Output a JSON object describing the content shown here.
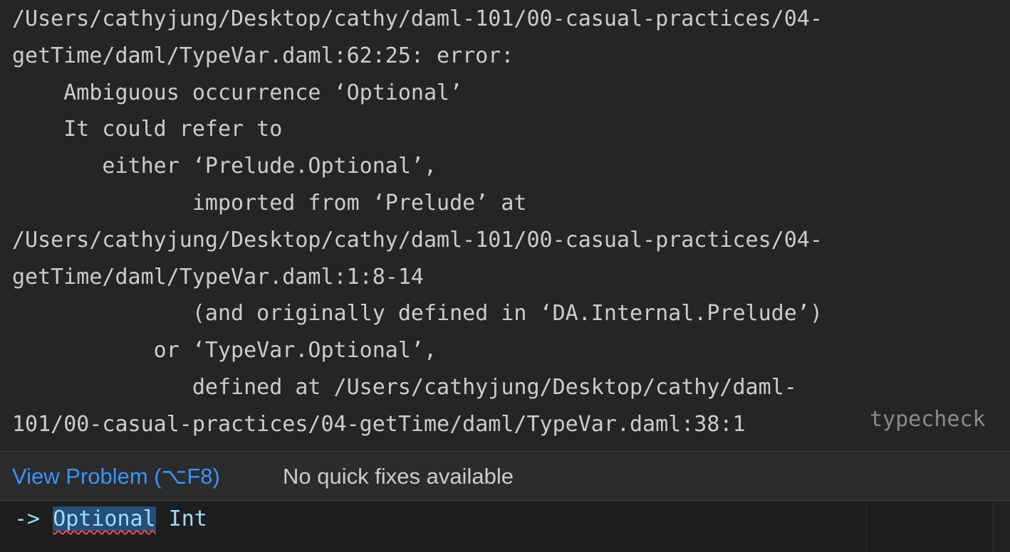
{
  "hover": {
    "error_text": "/Users/cathyjung/Desktop/cathy/daml-101/00-casual-practices/04-\ngetTime/daml/TypeVar.daml:62:25: error:\n    Ambiguous occurrence ‘Optional’\n    It could refer to\n       either ‘Prelude.Optional’,\n              imported from ‘Prelude’ at\n/Users/cathyjung/Desktop/cathy/daml-101/00-casual-practices/04-\ngetTime/daml/TypeVar.daml:1:8-14\n              (and originally defined in ‘DA.Internal.Prelude’)\n           or ‘TypeVar.Optional’,\n              defined at /Users/cathyjung/Desktop/cathy/daml-\n101/00-casual-practices/04-getTime/daml/TypeVar.daml:38:1",
    "source": "typecheck",
    "view_problem_label": "View Problem (⌥F8)",
    "no_fixes_label": "No quick fixes available"
  },
  "editor": {
    "arrow": "->",
    "type_highlighted": "Optional",
    "type_arg": "Int"
  },
  "colors": {
    "link": "#3794ff",
    "error_squiggle": "#f14c4c",
    "hover_background": "#252526",
    "editor_background": "#1e1e1e"
  }
}
